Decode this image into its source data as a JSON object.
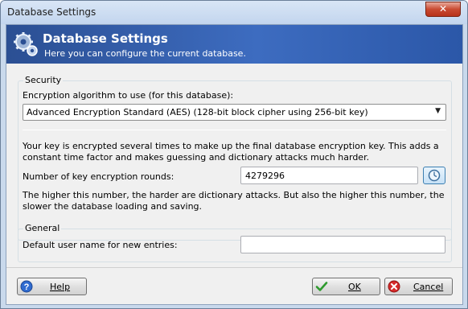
{
  "window": {
    "title": "Database Settings",
    "close_label": "✕"
  },
  "banner": {
    "title": "Database Settings",
    "subtitle": "Here you can configure the current database."
  },
  "security": {
    "group_label": "Security",
    "algorithm_label": "Encryption algorithm to use (for this database):",
    "algorithm_selected": "Advanced Encryption Standard (AES) (128-bit block cipher using 256-bit key)",
    "key_info": "Your key is encrypted several times to make up the final database encryption key. This adds a constant time factor and makes guessing and dictionary attacks much harder.",
    "rounds_label": "Number of key encryption rounds:",
    "rounds_value": "4279296",
    "rounds_note": "The higher this number, the harder are dictionary attacks. But also the higher this number, the slower the database loading and saving."
  },
  "general": {
    "group_label": "General",
    "default_user_label": "Default user name for new entries:",
    "default_user_value": ""
  },
  "buttons": {
    "help": "Help",
    "ok": "OK",
    "cancel": "Cancel"
  },
  "icons": {
    "banner": "gears-icon",
    "help": "help-icon",
    "ok": "checkmark-icon",
    "cancel": "cancel-icon",
    "benchmark": "clock-icon"
  }
}
